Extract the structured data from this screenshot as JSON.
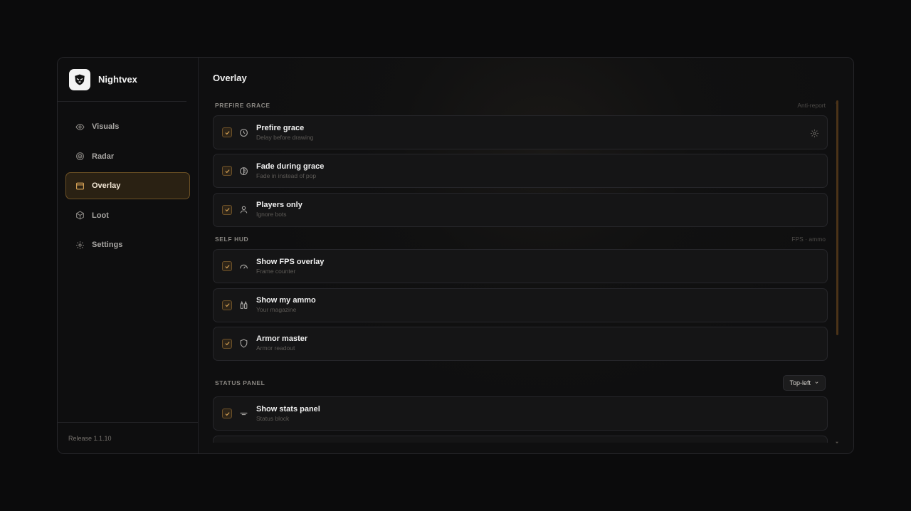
{
  "app": {
    "name": "Nightvex",
    "release": "Release 1.1.10"
  },
  "sidebar": {
    "items": [
      {
        "label": "Visuals",
        "icon": "eye-icon",
        "active": false
      },
      {
        "label": "Radar",
        "icon": "radar-icon",
        "active": false
      },
      {
        "label": "Overlay",
        "icon": "window-icon",
        "active": true
      },
      {
        "label": "Loot",
        "icon": "box-icon",
        "active": false
      },
      {
        "label": "Settings",
        "icon": "gear-icon",
        "active": false
      }
    ]
  },
  "main": {
    "title": "Overlay",
    "sections": [
      {
        "label": "PREFIRE GRACE",
        "hint": "Anti-report",
        "rows": [
          {
            "title": "Prefire grace",
            "subtitle": "Delay before drawing",
            "icon": "clock-icon",
            "checked": true,
            "has_settings": true
          },
          {
            "title": "Fade during grace",
            "subtitle": "Fade in instead of pop",
            "icon": "contrast-icon",
            "checked": true
          },
          {
            "title": "Players only",
            "subtitle": "Ignore bots",
            "icon": "user-icon",
            "checked": true
          }
        ]
      },
      {
        "label": "SELF HUD",
        "hint": "FPS · ammo",
        "rows": [
          {
            "title": "Show FPS overlay",
            "subtitle": "Frame counter",
            "icon": "gauge-icon",
            "checked": true
          },
          {
            "title": "Show my ammo",
            "subtitle": "Your magazine",
            "icon": "ammo-icon",
            "checked": true
          },
          {
            "title": "Armor master",
            "subtitle": "Armor readout",
            "icon": "shield-icon",
            "checked": true
          }
        ]
      },
      {
        "label": "STATUS PANEL",
        "dropdown": "Top-left",
        "rows": [
          {
            "title": "Show stats panel",
            "subtitle": "Status block",
            "icon": "lines-icon",
            "checked": true
          }
        ]
      }
    ]
  },
  "colors": {
    "accent": "#c9974a",
    "active_bg": "#2a2113",
    "active_border": "#6e5225",
    "scrollbar": "#4b3318"
  }
}
